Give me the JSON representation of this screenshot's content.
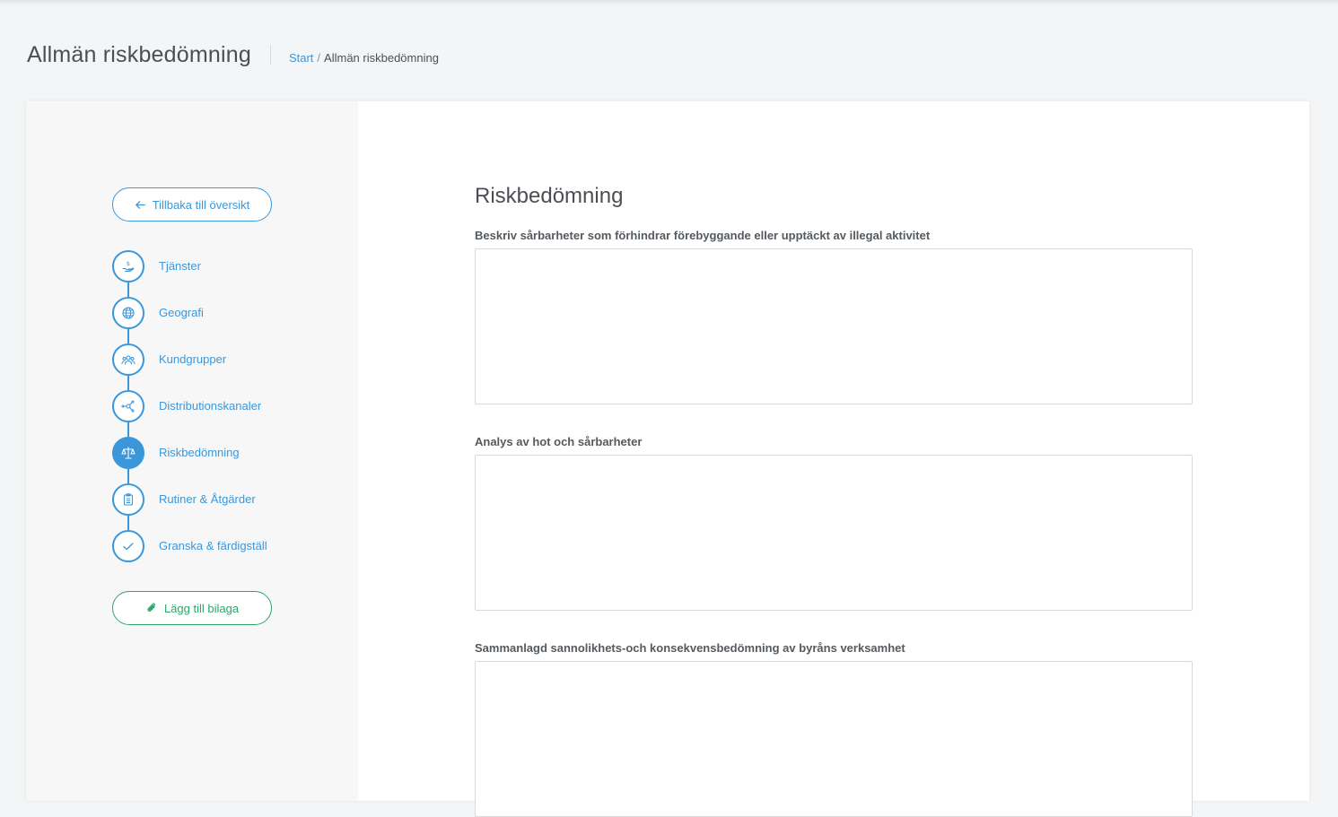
{
  "header": {
    "title": "Allmän riskbedömning",
    "breadcrumb": {
      "start": "Start",
      "separator": "/",
      "current": "Allmän riskbedömning"
    }
  },
  "sidebar": {
    "back_label": "Tillbaka till översikt",
    "attach_label": "Lägg till bilaga",
    "steps": [
      {
        "label": "Tjänster",
        "icon": "hand-money-icon"
      },
      {
        "label": "Geografi",
        "icon": "globe-icon"
      },
      {
        "label": "Kundgrupper",
        "icon": "people-group-icon"
      },
      {
        "label": "Distributionskanaler",
        "icon": "network-nodes-icon"
      },
      {
        "label": "Riskbedömning",
        "icon": "scales-icon",
        "active": true
      },
      {
        "label": "Rutiner & Åtgärder",
        "icon": "clipboard-icon"
      },
      {
        "label": "Granska & färdigställ",
        "icon": "check-icon"
      }
    ]
  },
  "main": {
    "title": "Riskbedömning",
    "fields": [
      {
        "label": "Beskriv sårbarheter som förhindrar förebyggande eller upptäckt av illegal aktivitet",
        "value": ""
      },
      {
        "label": "Analys av hot och sårbarheter",
        "value": ""
      },
      {
        "label": "Sammanlagd sannolikhets-och konsekvensbedömning av byråns verksamhet",
        "value": ""
      }
    ]
  },
  "colors": {
    "accent": "#3b97d9",
    "success": "#2ea56a",
    "background": "#f4f5f6",
    "sidebar_bg": "#f7f7f8"
  }
}
